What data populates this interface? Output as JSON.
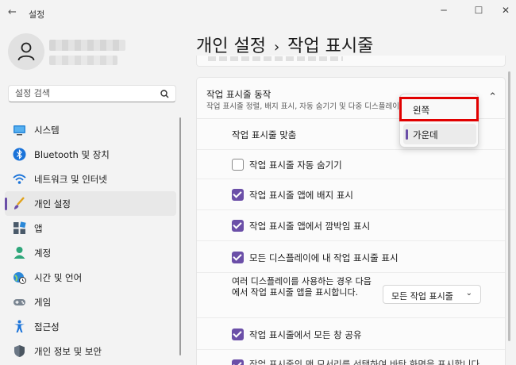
{
  "window": {
    "app_title": "설정"
  },
  "search": {
    "placeholder": "설정 검색"
  },
  "sidebar": {
    "items": [
      {
        "label": "시스템"
      },
      {
        "label": "Bluetooth 및 장치"
      },
      {
        "label": "네트워크 및 인터넷"
      },
      {
        "label": "개인 설정",
        "active": true
      },
      {
        "label": "앱"
      },
      {
        "label": "계정"
      },
      {
        "label": "시간 및 언어"
      },
      {
        "label": "게임"
      },
      {
        "label": "접근성"
      },
      {
        "label": "개인 정보 및 보안"
      }
    ]
  },
  "header": {
    "crumb": "개인 설정",
    "separator": "›",
    "page": "작업 표시줄"
  },
  "section": {
    "title": "작업 표시줄 동작",
    "description": "작업 표시줄 정렬, 배지 표시, 자동 숨기기 및 다중 디스플레이"
  },
  "settings": {
    "alignment_label": "작업 표시줄 맞춤",
    "auto_hide": {
      "label": "작업 표시줄 자동 숨기기",
      "checked": false
    },
    "badges": {
      "label": "작업 표시줄 앱에 배지 표시",
      "checked": true
    },
    "flashing": {
      "label": "작업 표시줄 앱에서 깜박임 표시",
      "checked": true
    },
    "all_displays": {
      "label": "모든 디스플레이에 내 작업 표시줄 표시",
      "checked": true
    },
    "multi_display_label": "여러 디스플레이를 사용하는 경우 다음에서 작업 표시줄 앱을 표시합니다.",
    "multi_display_value": "모든 작업 표시줄",
    "share_windows": {
      "label": "작업 표시줄에서 모든 창 공유",
      "checked": true
    },
    "far_corner_partial": "작업 표시줄의 맨 모서리를 선택하여 바탕 화면을 표시합니다"
  },
  "dropdown": {
    "options": [
      "왼쪽",
      "가운데"
    ],
    "selected": "가운데",
    "highlighted": "왼쪽"
  },
  "colors": {
    "accent": "#6b4fa8",
    "highlight_box": "#e10000"
  }
}
